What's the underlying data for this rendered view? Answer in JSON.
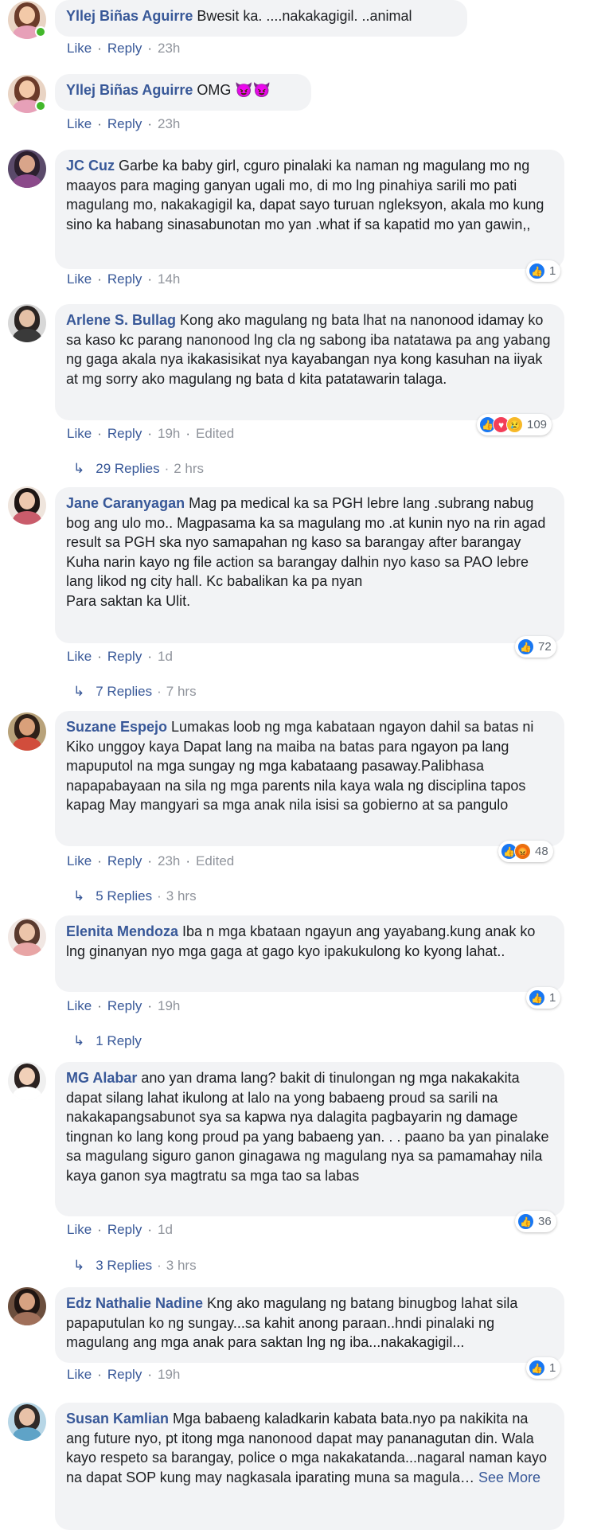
{
  "colors": {
    "name": "#385898",
    "bubble": "#f2f3f5",
    "like": "#1877f2",
    "love": "#f33e58",
    "online": "#42b72a"
  },
  "labels": {
    "like": "Like",
    "reply": "Reply",
    "edited": "Edited",
    "see_more": "See More"
  },
  "comments": [
    {
      "name": "Yllej Biñas Aguirre",
      "text": "Bwesit ka. ....nakakagigil. ..animal",
      "time": "23h",
      "online": true
    },
    {
      "name": "Yllej Biñas Aguirre",
      "text": "OMG 😈😈",
      "time": "23h",
      "online": true
    },
    {
      "name": "JC Cuz",
      "text": "Garbe ka baby girl, cguro pinalaki ka naman ng magulang mo ng maayos para maging ganyan ugali mo, di mo lng pinahiya sarili mo pati magulang mo, nakakagigil ka, dapat sayo turuan ngleksyon, akala mo kung sino ka habang sinasabunotan mo yan .what if sa kapatid mo yan gawin,,",
      "time": "14h",
      "reactions": {
        "icons": [
          "like"
        ],
        "count": "1"
      }
    },
    {
      "name": "Arlene S. Bullag",
      "text": "Kong ako magulang ng bata lhat na nanonood idamay ko sa kaso kc parang nanonood lng cla ng sabong iba natatawa pa ang yabang ng gaga akala nya ikakasisikat nya kayabangan nya kong kasuhan na iiyak at mg sorry ako magulang ng bata d kita patatawarin talaga.",
      "time": "19h",
      "edited": true,
      "reactions": {
        "icons": [
          "like",
          "love",
          "sad"
        ],
        "count": "109"
      },
      "replies": {
        "count": "29 Replies",
        "time": "2 hrs"
      }
    },
    {
      "name": "Jane Caranyagan",
      "text": "Mag pa medical ka sa PGH lebre lang .subrang nabug bog ang ulo mo.. Magpasama ka sa magulang mo .at kunin nyo na rin agad result sa PGH ska nyo samapahan ng kaso sa barangay after barangay Kuha narin kayo ng file action sa barangay dalhin nyo kaso sa PAO lebre lang likod ng city hall. Kc babalikan ka pa nyan\nPara saktan ka Ulit.",
      "time": "1d",
      "reactions": {
        "icons": [
          "like"
        ],
        "count": "72"
      },
      "replies": {
        "count": "7 Replies",
        "time": "7 hrs"
      }
    },
    {
      "name": "Suzane Espejo",
      "text": "Lumakas loob ng mga kabataan ngayon dahil sa batas ni Kiko unggoy kaya Dapat lang na maiba na batas para ngayon pa lang mapuputol na mga sungay ng mga kabataang pasaway.Palibhasa napapabayaan na sila ng mga parents nila kaya wala ng disciplina tapos kapag May mangyari sa mga anak nila isisi sa gobierno at sa pangulo",
      "time": "23h",
      "edited": true,
      "reactions": {
        "icons": [
          "like",
          "angry"
        ],
        "count": "48"
      },
      "replies": {
        "count": "5 Replies",
        "time": "3 hrs"
      }
    },
    {
      "name": "Elenita Mendoza",
      "text": "Iba n mga kbataan ngayun ang yayabang.kung anak ko lng ginanyan nyo mga gaga at gago kyo ipakukulong ko kyong lahat..",
      "time": "19h",
      "reactions": {
        "icons": [
          "like"
        ],
        "count": "1"
      },
      "replies": {
        "count": "1 Reply",
        "time": ""
      }
    },
    {
      "name": "MG Alabar",
      "text": "ano yan drama lang? bakit di tinulongan ng mga nakakakita dapat silang lahat ikulong at lalo na yong babaeng proud sa sarili na nakakapangsabunot sya sa kapwa nya dalagita pagbayarin ng damage tingnan ko lang kong proud pa yang babaeng yan. . . paano ba yan pinalake sa magulang siguro ganon ginagawa ng magulang nya sa pamamahay nila kaya ganon sya magtratu sa mga tao sa labas",
      "time": "1d",
      "reactions": {
        "icons": [
          "like"
        ],
        "count": "36"
      },
      "replies": {
        "count": "3 Replies",
        "time": "3 hrs"
      }
    },
    {
      "name": "Edz Nathalie Nadine",
      "text": "Kng ako magulang ng batang binugbog lahat sila papaputulan ko ng sungay...sa kahit anong paraan..hndi pinalaki ng magulang ang mga anak para saktan lng ng iba...nakakagigil...",
      "time": "19h",
      "reactions": {
        "icons": [
          "like"
        ],
        "count": "1"
      }
    },
    {
      "name": "Susan Kamlian",
      "text": "Mga babaeng kaladkarin kabata bata.nyo pa nakikita na ang future nyo, pt itong mga nanonood dapat may pananagutan din. Wala kayo respeto sa barangay, police o mga nakakatanda...nagaral naman kayo na dapat SOP kung may nagkasala iparating muna sa magula…",
      "time": ""
    }
  ]
}
